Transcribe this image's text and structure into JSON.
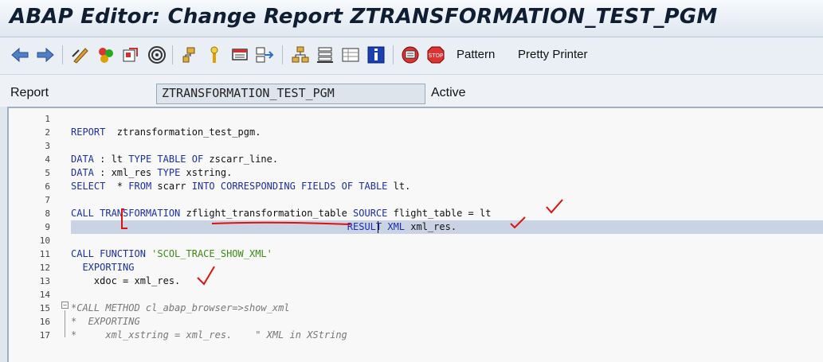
{
  "window": {
    "title": "ABAP Editor: Change Report ZTRANSFORMATION_TEST_PGM"
  },
  "toolbar": {
    "pattern_label": "Pattern",
    "pretty_printer_label": "Pretty Printer",
    "icons": [
      "back-arrow-icon",
      "forward-arrow-icon",
      "display-change-icon",
      "activate-icon",
      "check-icon",
      "test-icon",
      "where-used-icon",
      "display-object-list-icon",
      "breakpoint-icon",
      "mime-icon",
      "navigation-icon",
      "object-list-icon",
      "structure-icon",
      "help-icon",
      "info-icon",
      "set-breakpoint-icon",
      "stop-icon"
    ]
  },
  "report": {
    "label": "Report",
    "name": "ZTRANSFORMATION_TEST_PGM",
    "status": "Active"
  },
  "editor": {
    "lines": [
      {
        "n": "1",
        "parts": []
      },
      {
        "n": "2",
        "parts": [
          [
            "kw",
            "REPORT"
          ],
          [
            "plain",
            "  ztransformation_test_pgm."
          ]
        ]
      },
      {
        "n": "3",
        "parts": []
      },
      {
        "n": "4",
        "parts": [
          [
            "kw",
            "DATA"
          ],
          [
            "plain",
            " : lt "
          ],
          [
            "kw",
            "TYPE TABLE OF"
          ],
          [
            "plain",
            " zscarr_line."
          ]
        ]
      },
      {
        "n": "5",
        "parts": [
          [
            "kw",
            "DATA"
          ],
          [
            "plain",
            " : xml_res "
          ],
          [
            "kw",
            "TYPE"
          ],
          [
            "plain",
            " xstring."
          ]
        ]
      },
      {
        "n": "6",
        "parts": [
          [
            "kw",
            "SELECT"
          ],
          [
            "plain",
            "  * "
          ],
          [
            "kw",
            "FROM"
          ],
          [
            "plain",
            " scarr "
          ],
          [
            "kw",
            "INTO CORRESPONDING FIELDS OF TABLE"
          ],
          [
            "plain",
            " lt."
          ]
        ]
      },
      {
        "n": "7",
        "parts": []
      },
      {
        "n": "8",
        "parts": [
          [
            "kw",
            "CALL TRANSFORMATION"
          ],
          [
            "plain",
            " zflight_transformation_table "
          ],
          [
            "kw",
            "SOURCE"
          ],
          [
            "plain",
            " flight_table = lt"
          ]
        ]
      },
      {
        "n": "9",
        "parts": [
          [
            "plain",
            "                                                "
          ],
          [
            "kw",
            "RESULT XML"
          ],
          [
            "plain",
            " xml_res."
          ]
        ]
      },
      {
        "n": "10",
        "parts": []
      },
      {
        "n": "11",
        "parts": [
          [
            "kw",
            "CALL FUNCTION"
          ],
          [
            "plain",
            " "
          ],
          [
            "str",
            "'SCOL_TRACE_SHOW_XML'"
          ]
        ]
      },
      {
        "n": "12",
        "parts": [
          [
            "plain",
            "  "
          ],
          [
            "kw",
            "EXPORTING"
          ]
        ]
      },
      {
        "n": "13",
        "parts": [
          [
            "plain",
            "    xdoc = xml_res."
          ]
        ]
      },
      {
        "n": "14",
        "parts": []
      },
      {
        "n": "15",
        "parts": [
          [
            "com",
            "*CALL METHOD cl_abap_browser=>show_xml"
          ]
        ]
      },
      {
        "n": "16",
        "parts": [
          [
            "com",
            "*  EXPORTING"
          ]
        ]
      },
      {
        "n": "17",
        "parts": [
          [
            "com",
            "*     xml_xstring = xml_res.    \" XML in XString"
          ]
        ]
      }
    ]
  },
  "colors": {
    "keyword": "#1c2fa6",
    "string": "#3d8a14",
    "comment": "#777777",
    "annotation": "#e01010"
  }
}
